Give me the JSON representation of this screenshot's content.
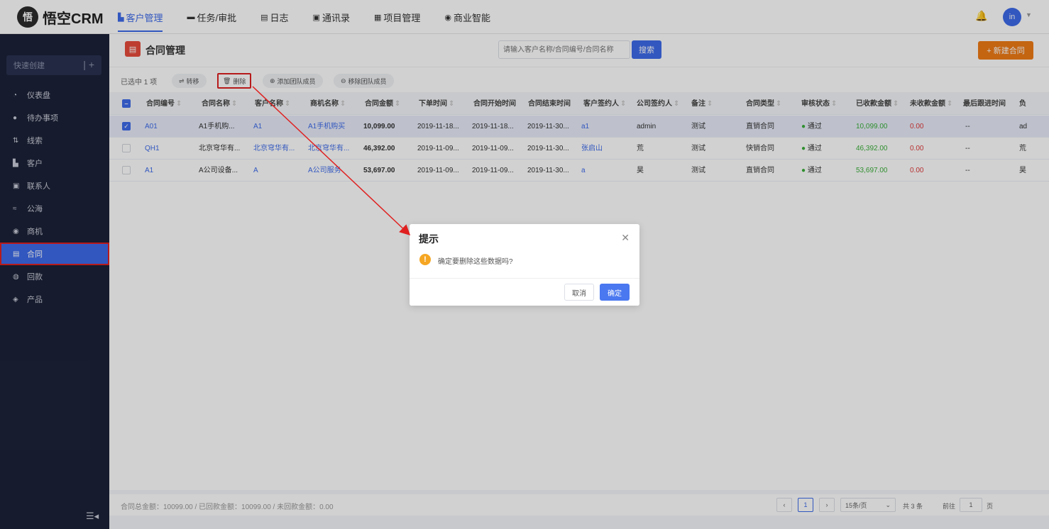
{
  "logo": {
    "mark": "悟",
    "text": "悟空CRM"
  },
  "nav": [
    {
      "icon": "▙",
      "label": "客户管理"
    },
    {
      "icon": "▬",
      "label": "任务/审批"
    },
    {
      "icon": "▤",
      "label": "日志"
    },
    {
      "icon": "▣",
      "label": "通讯录"
    },
    {
      "icon": "▦",
      "label": "项目管理"
    },
    {
      "icon": "◉",
      "label": "商业智能"
    }
  ],
  "user": {
    "avatar_text": "in"
  },
  "sidebar": {
    "quick_create": "快速创建",
    "items": [
      {
        "icon": "◔",
        "label": "仪表盘"
      },
      {
        "icon": "●",
        "label": "待办事项"
      },
      {
        "icon": "⇅",
        "label": "线索"
      },
      {
        "icon": "▙",
        "label": "客户"
      },
      {
        "icon": "▣",
        "label": "联系人"
      },
      {
        "icon": "≈",
        "label": "公海"
      },
      {
        "icon": "◉",
        "label": "商机"
      },
      {
        "icon": "▤",
        "label": "合同"
      },
      {
        "icon": "◍",
        "label": "回款"
      },
      {
        "icon": "◈",
        "label": "产品"
      }
    ]
  },
  "header": {
    "title": "合同管理",
    "search_placeholder": "请输入客户名称/合同编号/合同名称",
    "search_label": "搜索",
    "new_label": "+ 新建合同"
  },
  "toolbar": {
    "selected": "已选中 1 项",
    "transfer": "转移",
    "delete": "删除",
    "add_member": "添加团队成员",
    "remove_member": "移除团队成员"
  },
  "table": {
    "columns": [
      "合同编号",
      "合同名称",
      "客户名称",
      "商机名称",
      "合同金额",
      "下单时间",
      "合同开始时间",
      "合同结束时间",
      "客户签约人",
      "公司签约人",
      "备注",
      "合同类型",
      "审核状态",
      "已收款金额",
      "未收款金额",
      "最后跟进时间",
      "负"
    ],
    "rows": [
      [
        "A01",
        "A1手机购...",
        "A1",
        "A1手机购买",
        "10,099.00",
        "2019-11-18...",
        "2019-11-18...",
        "2019-11-30...",
        "a1",
        "admin",
        "测试",
        "直销合同",
        "通过",
        "10,099.00",
        "0.00",
        "--",
        "ad"
      ],
      [
        "QH1",
        "北京穹华有...",
        "北京穹华有...",
        "北京穹华有...",
        "46,392.00",
        "2019-11-09...",
        "2019-11-09...",
        "2019-11-30...",
        "张启山",
        "荒",
        "测试",
        "快销合同",
        "通过",
        "46,392.00",
        "0.00",
        "--",
        "荒"
      ],
      [
        "A1",
        "A公司设备...",
        "A",
        "A公司服务",
        "53,697.00",
        "2019-11-09...",
        "2019-11-09...",
        "2019-11-30...",
        "a",
        "昊",
        "测试",
        "直销合同",
        "通过",
        "53,697.00",
        "0.00",
        "--",
        "昊"
      ]
    ]
  },
  "footer": {
    "totals": "合同总金额：10099.00 / 已回款金额：10099.00 / 未回款金额：0.00",
    "page": "1",
    "page_size": "15条/页",
    "total_count": "共 3 条",
    "goto_prefix": "前往",
    "goto_value": "1",
    "goto_suffix": "页"
  },
  "dialog": {
    "title": "提示",
    "message": "确定要删除这些数据吗?",
    "cancel": "取消",
    "confirm": "确定"
  },
  "colors": {
    "accent": "#3e6bea",
    "orange": "#f07c17",
    "highlight": "#e02020",
    "sidebar": "#1c2238"
  }
}
